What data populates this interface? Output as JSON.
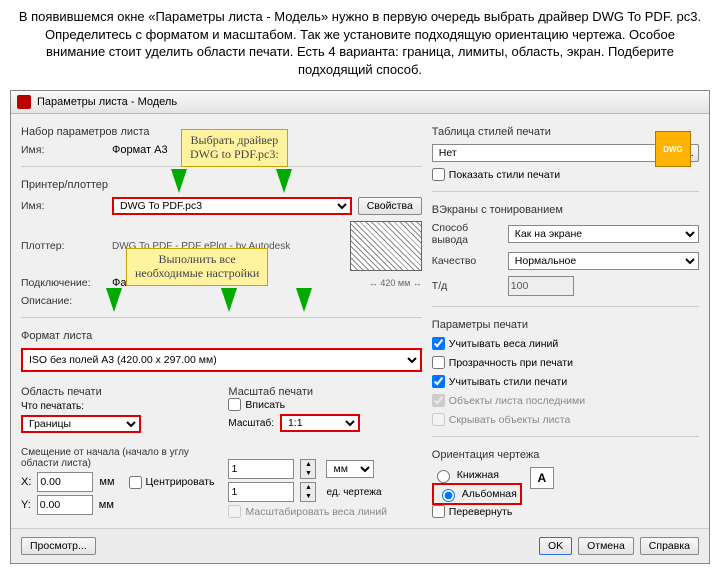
{
  "caption": "В появившемся окне «Параметры листа - Модель» нужно в первую очередь выбрать драйвер DWG To PDF. pc3. Определитесь с форматом и масштабом. Так же установите подходящую ориентацию чертежа. Особое внимание стоит уделить области печати. Есть 4 варианта: граница, лимиты, область, экран. Подберите подходящий способ.",
  "window": {
    "title": "Параметры листа - Модель"
  },
  "callouts": {
    "c1a": "Выбрать драйвер",
    "c1b": "DWG to PDF.pc3:",
    "c2a": "Выполнить все",
    "c2b": "необходимые настройки"
  },
  "left": {
    "grp_set": "Набор параметров листа",
    "name_lbl": "Имя:",
    "name_val": "Формат А3",
    "dwg": "DWG",
    "grp_printer": "Принтер/плоттер",
    "pr_name_lbl": "Имя:",
    "pr_name_val": "DWG To PDF.pc3",
    "props_btn": "Свойства",
    "plotter_lbl": "Плоттер:",
    "plotter_val": "DWG To PDF - PDF ePlot - by Autodesk",
    "where_lbl": "Подключение:",
    "where_val": "Файл",
    "desc_lbl": "Описание:",
    "size_hint": "↔ 420 мм ↔",
    "grp_format": "Формат листа",
    "format_val": "ISO без полей A3 (420.00 x 297.00 мм)",
    "grp_area": "Область печати",
    "area_lbl": "Что печатать:",
    "area_val": "Границы",
    "grp_offset": "Смещение от начала (начало в углу области листа)",
    "x_lbl": "X:",
    "x_val": "0.00",
    "x_unit": "мм",
    "y_lbl": "Y:",
    "y_val": "0.00",
    "y_unit": "мм",
    "center_chk": "Центрировать",
    "preview_btn": "Просмотр..."
  },
  "mid": {
    "grp_scale": "Масштаб печати",
    "fit_chk": "Вписать",
    "scale_lbl": "Масштаб:",
    "scale_val": "1:1",
    "unit_val": "1",
    "unit_sel": "мм",
    "du_val": "1",
    "du_lbl": "ед. чертежа",
    "lw_chk": "Масштабировать веса линий"
  },
  "right": {
    "grp_styles": "Таблица стилей печати",
    "styles_val": "Нет",
    "show_styles_chk": "Показать стили печати",
    "grp_shade": "ВЭкраны с тонированием",
    "shade_way_lbl": "Способ вывода",
    "shade_way_val": "Как на экране",
    "quality_lbl": "Качество",
    "quality_val": "Нормальное",
    "dpi_lbl": "Т/д",
    "dpi_val": "100",
    "grp_opts": "Параметры печати",
    "opt1": "Учитывать веса линий",
    "opt2": "Прозрачность при печати",
    "opt3": "Учитывать стили печати",
    "opt4": "Объекты листа последними",
    "opt5": "Скрывать объекты листа",
    "grp_orient": "Ориентация чертежа",
    "or1": "Книжная",
    "or2": "Альбомная",
    "or3_chk": "Перевернуть",
    "orA": "A"
  },
  "btns": {
    "ok": "OK",
    "cancel": "Отмена",
    "help": "Справка"
  }
}
